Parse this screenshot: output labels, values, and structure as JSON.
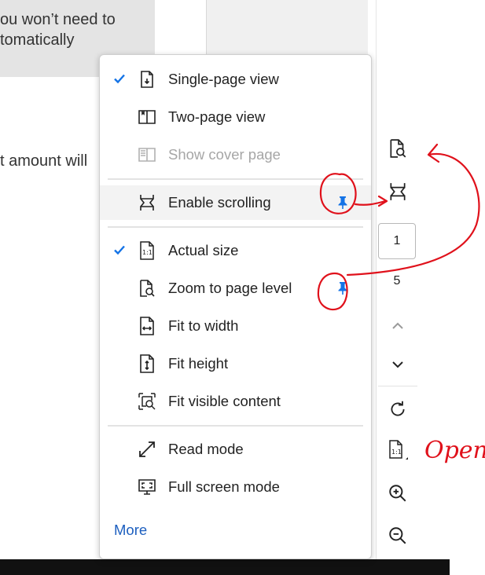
{
  "document": {
    "line1": "ou won’t need to",
    "line2": "tomatically",
    "line3": "t amount will"
  },
  "menu": {
    "items": [
      {
        "label": "Single-page view",
        "icon": "single-page-view-icon",
        "checked": true
      },
      {
        "label": "Two-page view",
        "icon": "two-page-view-icon"
      },
      {
        "label": "Show cover page",
        "icon": "cover-page-icon",
        "disabled": true
      },
      {
        "label": "Enable scrolling",
        "icon": "scroll-icon",
        "pinned": true
      },
      {
        "label": "Actual size",
        "icon": "actual-size-icon",
        "checked": true
      },
      {
        "label": "Zoom to page level",
        "icon": "zoom-page-icon",
        "pinned": true
      },
      {
        "label": "Fit to width",
        "icon": "fit-width-icon"
      },
      {
        "label": "Fit height",
        "icon": "fit-height-icon"
      },
      {
        "label": "Fit visible content",
        "icon": "fit-visible-icon"
      },
      {
        "label": "Read mode",
        "icon": "read-mode-icon"
      },
      {
        "label": "Full screen mode",
        "icon": "full-screen-icon"
      }
    ],
    "more_label": "More"
  },
  "toolbar": {
    "current_page": "1",
    "total_pages": "5"
  },
  "annotation": {
    "note": "Open"
  },
  "colors": {
    "accent": "#1d5fbf",
    "check": "#1473e6",
    "annotation": "#e0111b"
  }
}
